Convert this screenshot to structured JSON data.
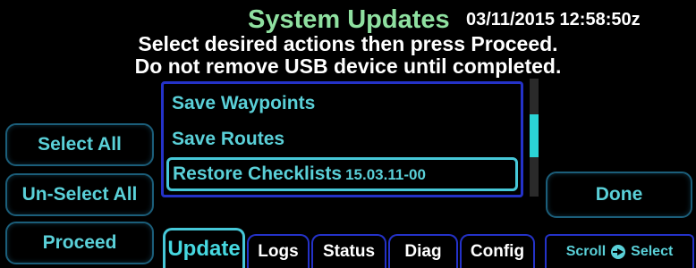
{
  "header": {
    "title": "System Updates",
    "clock": "03/11/2015 12:58:50z",
    "instruction_line1": "Select desired actions then press Proceed.",
    "instruction_line2": "Do not remove USB device until completed."
  },
  "actions": {
    "select_all": "Select All",
    "unselect_all": "Un-Select All",
    "proceed": "Proceed",
    "done": "Done"
  },
  "list": {
    "items": [
      {
        "label": "Save Waypoints",
        "version": ""
      },
      {
        "label": "Save Routes",
        "version": ""
      },
      {
        "label": "Restore Checklists",
        "version": "15.03.11-00",
        "selected": true
      }
    ],
    "scroll_position": 0.3
  },
  "tabs": [
    {
      "label": "Update",
      "active": true
    },
    {
      "label": "Logs",
      "active": false
    },
    {
      "label": "Status",
      "active": false
    },
    {
      "label": "Diag",
      "active": false
    },
    {
      "label": "Config",
      "active": false
    }
  ],
  "hint": {
    "scroll": "Scroll",
    "select": "Select",
    "icon": "knob-icon"
  },
  "colors": {
    "title": "#8fe0a0",
    "cyan_text": "#5ad0d8",
    "list_border": "#2432c8",
    "highlight": "#46c8d8",
    "scroll_thumb": "#2bd4d6"
  }
}
